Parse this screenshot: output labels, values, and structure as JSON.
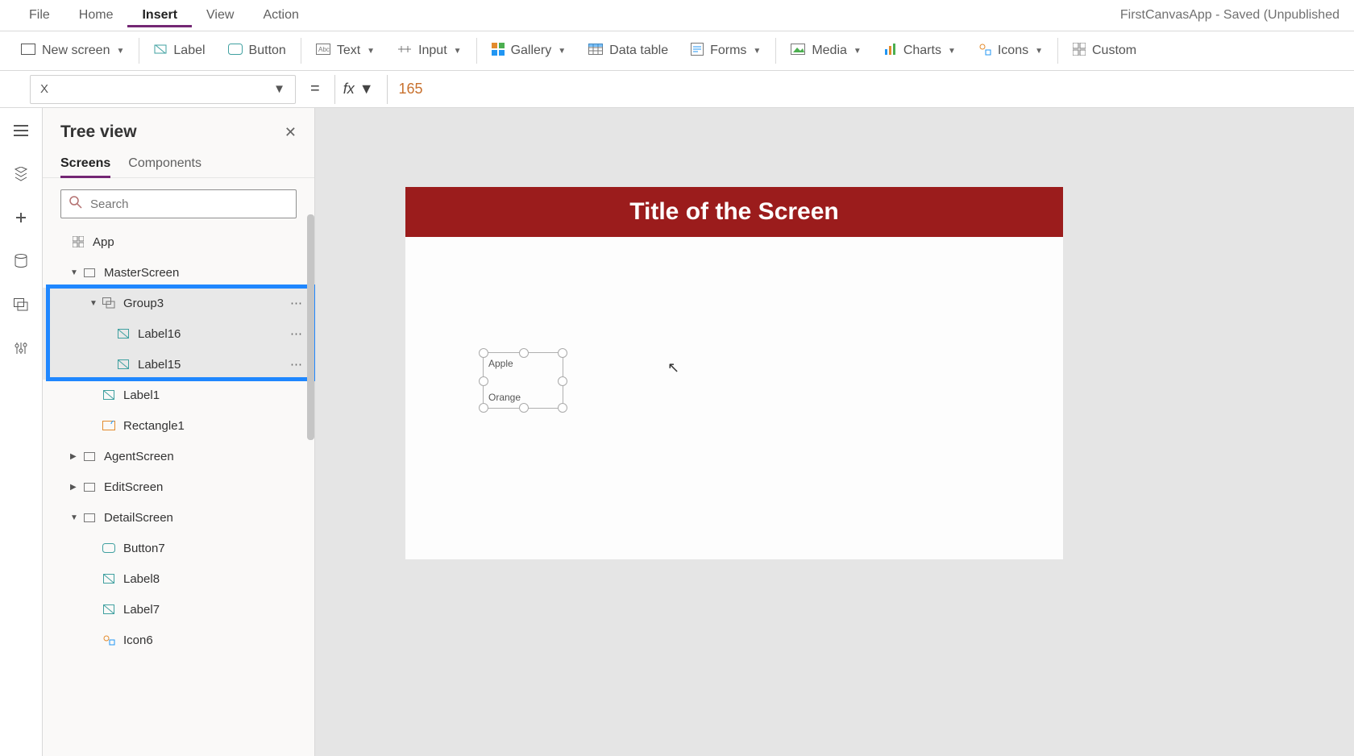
{
  "title_right": "FirstCanvasApp - Saved (Unpublished",
  "menu": {
    "file": "File",
    "home": "Home",
    "insert": "Insert",
    "view": "View",
    "action": "Action"
  },
  "ribbon": {
    "new_screen": "New screen",
    "label": "Label",
    "button": "Button",
    "text": "Text",
    "input": "Input",
    "gallery": "Gallery",
    "data_table": "Data table",
    "forms": "Forms",
    "media": "Media",
    "charts": "Charts",
    "icons": "Icons",
    "custom": "Custom"
  },
  "formula": {
    "property": "X",
    "value": "165",
    "fx": "fx"
  },
  "tree": {
    "title": "Tree view",
    "tabs": {
      "screens": "Screens",
      "components": "Components"
    },
    "search_placeholder": "Search",
    "items": {
      "app": "App",
      "master": "MasterScreen",
      "group3": "Group3",
      "label16": "Label16",
      "label15": "Label15",
      "label1": "Label1",
      "rect1": "Rectangle1",
      "agent": "AgentScreen",
      "edit": "EditScreen",
      "detail": "DetailScreen",
      "button7": "Button7",
      "label8": "Label8",
      "label7": "Label7",
      "icon6": "Icon6"
    }
  },
  "canvas": {
    "screen_title": "Title of the Screen",
    "group_label_top": "Apple",
    "group_label_bottom": "Orange"
  }
}
